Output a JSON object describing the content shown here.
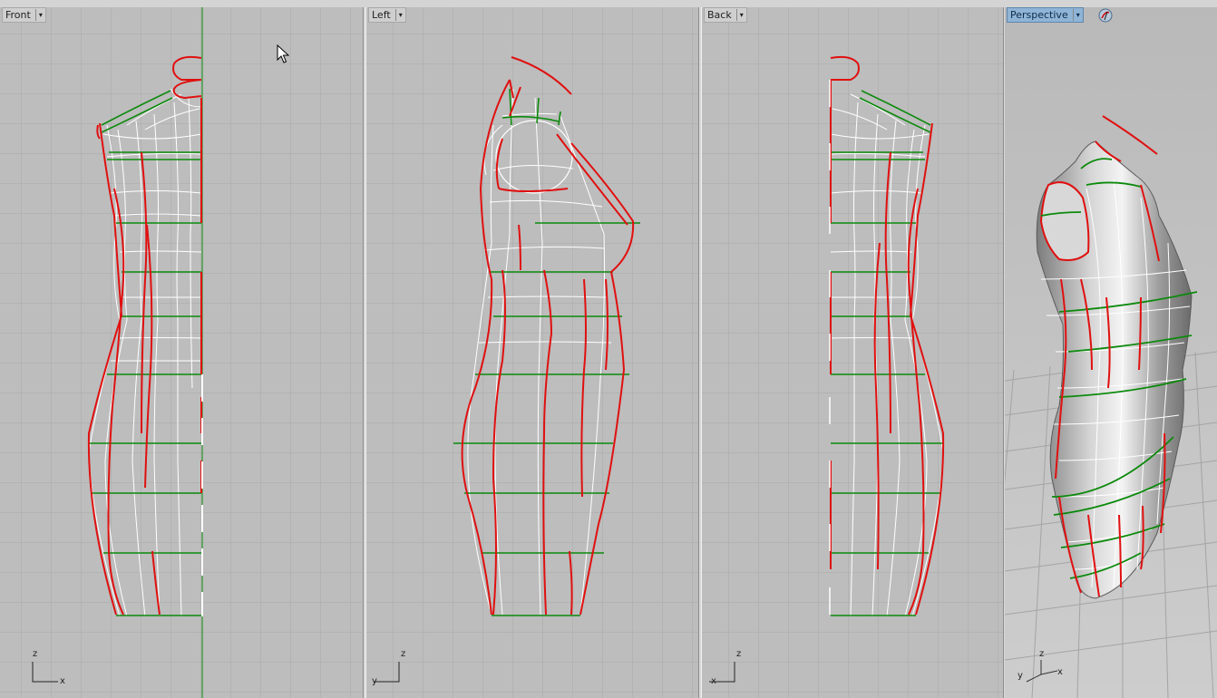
{
  "viewports": [
    {
      "id": "front",
      "label": "Front",
      "active": false,
      "axes": [
        "z",
        "x"
      ]
    },
    {
      "id": "left",
      "label": "Left",
      "active": false,
      "axes": [
        "z",
        "y"
      ]
    },
    {
      "id": "back",
      "label": "Back",
      "active": false,
      "axes": [
        "z",
        "x"
      ]
    },
    {
      "id": "perspective",
      "label": "Perspective",
      "active": true,
      "axes": [
        "z",
        "y",
        "x"
      ]
    }
  ],
  "dropdown_glyph": "▾",
  "colors": {
    "grid": "#a9a9a9",
    "background": "#bdbdbd",
    "curve_red": "#e01010",
    "curve_green": "#0c8a0c",
    "curve_white": "#ffffff",
    "active_tab": "#8fb4d6"
  },
  "icons": [
    "dropdown-arrow-icon",
    "mouse-cursor-icon",
    "perspective-rotate-icon",
    "axis-widget-icon"
  ]
}
